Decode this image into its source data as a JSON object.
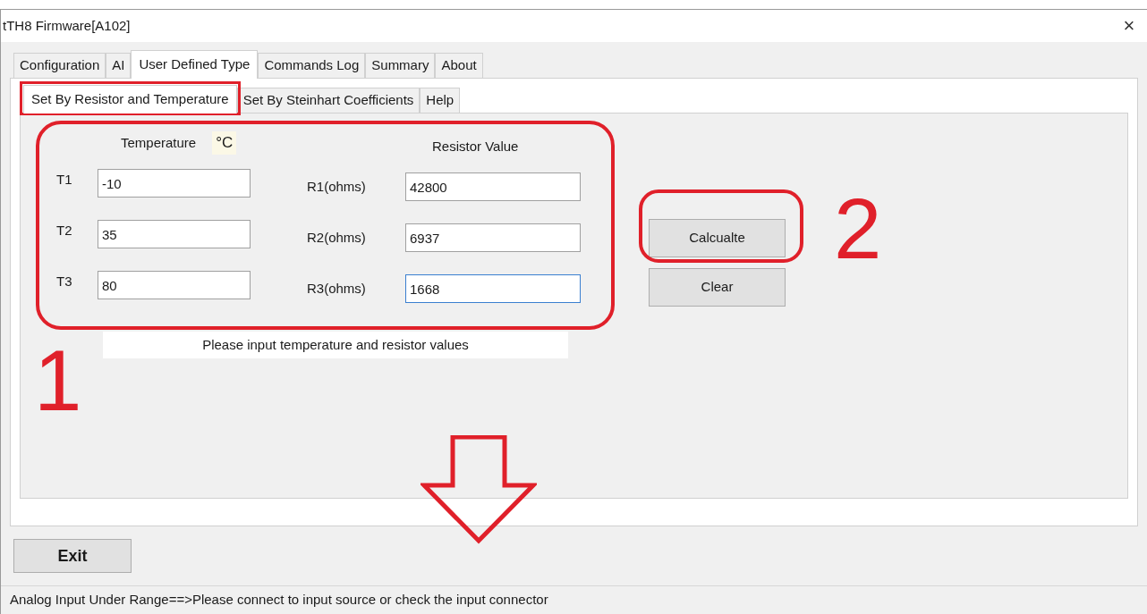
{
  "window": {
    "title": "tTH8 Firmware[A102]",
    "close": "×"
  },
  "tabs": [
    {
      "label": "Configuration",
      "selected": false
    },
    {
      "label": "AI",
      "selected": false
    },
    {
      "label": "User Defined Type",
      "selected": true
    },
    {
      "label": "Commands Log",
      "selected": false
    },
    {
      "label": "Summary",
      "selected": false
    },
    {
      "label": "About",
      "selected": false
    }
  ],
  "subtabs": [
    {
      "label": "Set By Resistor and Temperature",
      "selected": true
    },
    {
      "label": "Set By Steinhart Coefficients",
      "selected": false
    },
    {
      "label": "Help",
      "selected": false
    }
  ],
  "temperature_heading": "Temperature",
  "unit": "°C",
  "resistor_heading": "Resistor Value",
  "rows": [
    {
      "t_label": "T1",
      "t_value": "-10",
      "r_label": "R1(ohms)",
      "r_value": "42800",
      "focused": false
    },
    {
      "t_label": "T2",
      "t_value": "35",
      "r_label": "R2(ohms)",
      "r_value": "6937",
      "focused": false
    },
    {
      "t_label": "T3",
      "t_value": "80",
      "r_label": "R3(ohms)",
      "r_value": "1668",
      "focused": true
    }
  ],
  "buttons": [
    "Calcualte",
    "Clear"
  ],
  "message": "Please input temperature and resistor values",
  "exit_button": "Exit",
  "status_bar": "Analog Input Under Range==>Please connect to input source or check the input connector",
  "annotations": [
    {
      "label": "1"
    },
    {
      "label": "2"
    }
  ]
}
